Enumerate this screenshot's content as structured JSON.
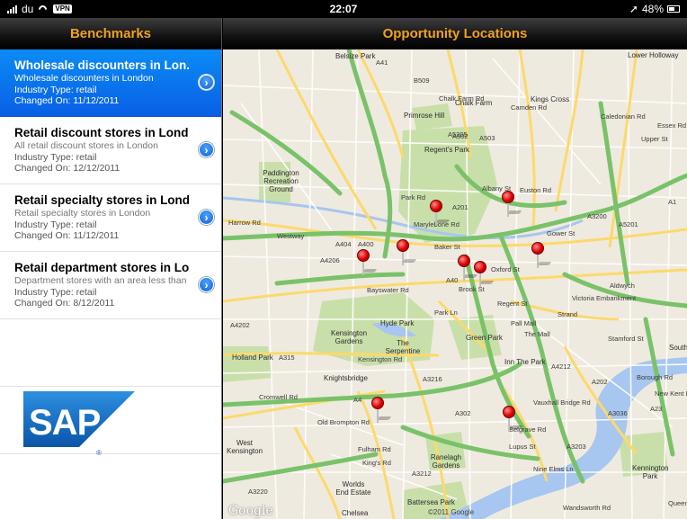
{
  "status_bar": {
    "carrier": "du",
    "vpn": "VPN",
    "time": "22:07",
    "battery": "48%"
  },
  "headers": {
    "left": "Benchmarks",
    "right": "Opportunity Locations"
  },
  "benchmarks": [
    {
      "title": "Wholesale discounters in Lon...",
      "description": "Wholesale discounters in London",
      "industry": "Industry Type: retail",
      "changed": "Changed On: 11/12/2011",
      "selected": true
    },
    {
      "title": "Retail discount stores in Lond...",
      "description": "All retail discount stores in London",
      "industry": "Industry Type: retail",
      "changed": "Changed On: 12/12/2011",
      "selected": false
    },
    {
      "title": "Retail specialty stores in Lond...",
      "description": "Retail specialty stores in London",
      "industry": "Industry Type: retail",
      "changed": "Changed On: 11/12/2011",
      "selected": false
    },
    {
      "title": "Retail department stores in Lo...",
      "description": "Department stores with an area less than",
      "industry": "Industry Type: retail",
      "changed": "Changed On: 8/12/2011",
      "selected": false
    }
  ],
  "logo": {
    "text": "SAP",
    "registered": "®",
    "color": "#1a73c9"
  },
  "map": {
    "attribution": "Google",
    "copyright": "©2011 Google",
    "area_labels": [
      "Belsize Park",
      "Lower Holloway",
      "Chalk Farm",
      "Kings Cross",
      "Primrose Hill",
      "Regent's Park",
      "Paddington Recreation Ground",
      "Hyde Park",
      "Kensington Gardens",
      "The Serpentine",
      "Green Park",
      "Inn The Park",
      "Holland Park",
      "Knightsbridge",
      "West Kensington",
      "Ranelagh Gardens",
      "Battersea Park",
      "Kennington Park",
      "Worlds End Estate",
      "Chelsea",
      "South"
    ],
    "road_labels": [
      "A41",
      "B509",
      "A502",
      "A503",
      "A1",
      "A5205",
      "Marylebone Rd",
      "Oxford St",
      "Bayswater Rd",
      "Harrow Rd",
      "A404",
      "A40",
      "A4206",
      "A4202",
      "A315",
      "A4",
      "A3216",
      "A302",
      "A3212",
      "A3220",
      "Old Brompton Rd",
      "Cromwell Rd",
      "Fulham Rd",
      "King's Rd",
      "Belgrave Rd",
      "Lupus St",
      "Vauxhall Bridge Rd",
      "A3203",
      "Nine Elms Ln",
      "Wandsworth Rd",
      "A3036",
      "A23",
      "A201",
      "A3200",
      "A5201",
      "Gower St",
      "Albany St",
      "Park Rd",
      "Baker St",
      "Park Ln",
      "Regent St",
      "Pall Mall",
      "The Mall",
      "Victoria Embankment",
      "Borough Rd",
      "A202",
      "Queens Rd",
      "New Kent Rd",
      "Stamford St",
      "A4212",
      "Aldwych",
      "Strand",
      "Westway",
      "Euston Rd",
      "A400",
      "Camden Rd",
      "Caledonian Rd",
      "Upper St",
      "Essex Rd",
      "Kensington Rd",
      "Brook St",
      "Chalk Farm Rd"
    ],
    "pin_count": 10
  }
}
